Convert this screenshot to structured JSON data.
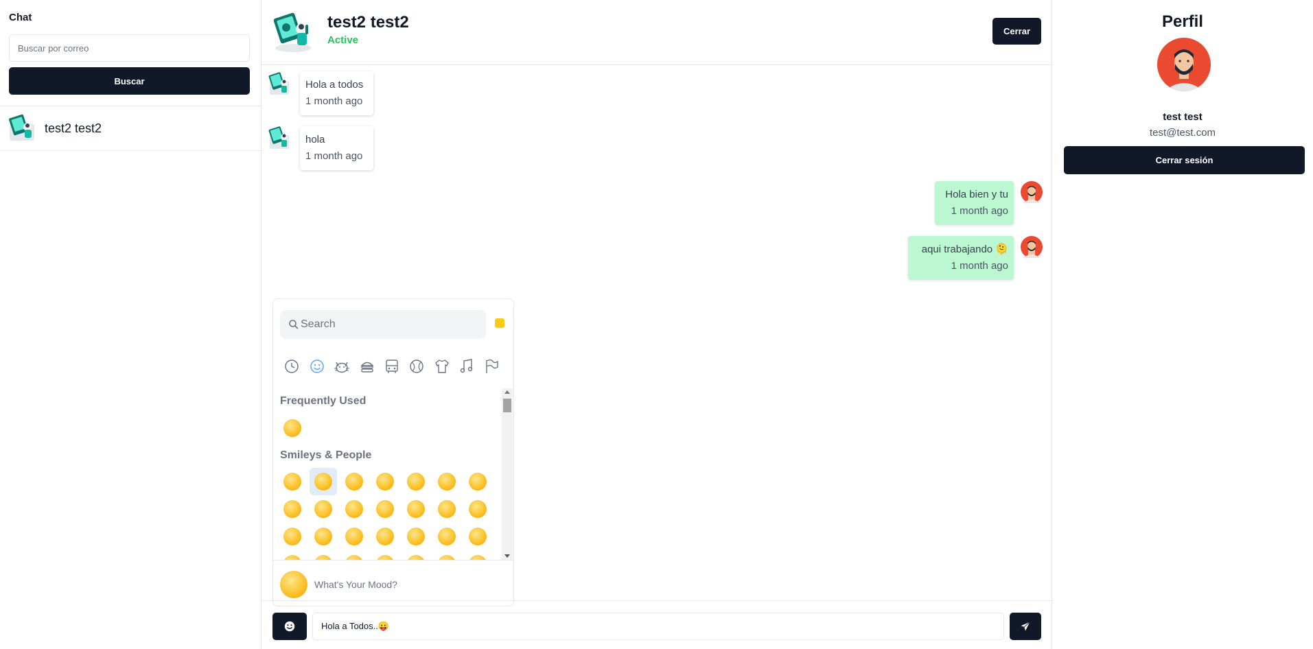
{
  "sidebar": {
    "title": "Chat",
    "search_placeholder": "Buscar por correo",
    "search_button": "Buscar",
    "contacts": [
      {
        "name": "test2 test2"
      }
    ]
  },
  "chat": {
    "contact_name": "test2 test2",
    "status": "Active",
    "close_button": "Cerrar",
    "messages": [
      {
        "direction": "in",
        "text": "Hola a todos",
        "time": "1 month ago"
      },
      {
        "direction": "in",
        "text": "hola",
        "time": "1 month ago"
      },
      {
        "direction": "out",
        "text": "Hola bien y tu",
        "time": "1 month ago"
      },
      {
        "direction": "out",
        "text": "aqui trabajando 🫠",
        "time": "1 month ago"
      }
    ],
    "composer_value": "Hola a Todos..😛"
  },
  "emoji_picker": {
    "search_placeholder": "Search",
    "skin_tone_color": "#facc15",
    "categories": [
      "recent-icon",
      "smileys-icon",
      "animals-icon",
      "food-icon",
      "travel-icon",
      "activity-icon",
      "objects-icon",
      "symbols-icon",
      "flags-icon"
    ],
    "sections": [
      {
        "title": "Frequently Used"
      },
      {
        "title": "Smileys & People"
      }
    ],
    "footer_text": "What's Your Mood?"
  },
  "profile": {
    "title": "Perfil",
    "name": "test test",
    "email": "test@test.com",
    "logout_button": "Cerrar sesión"
  },
  "colors": {
    "primary_dark": "#111827",
    "active_green": "#22c55e",
    "outgoing_bubble": "#bbf7d0"
  }
}
